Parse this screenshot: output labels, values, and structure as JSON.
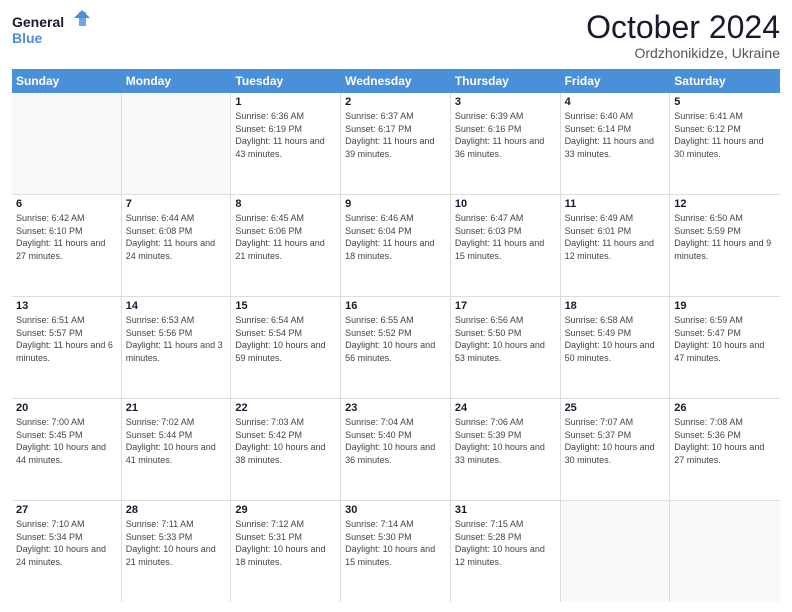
{
  "logo": {
    "line1": "General",
    "line2": "Blue"
  },
  "title": "October 2024",
  "subtitle": "Ordzhonikidze, Ukraine",
  "days": [
    "Sunday",
    "Monday",
    "Tuesday",
    "Wednesday",
    "Thursday",
    "Friday",
    "Saturday"
  ],
  "weeks": [
    [
      {
        "day": "",
        "info": ""
      },
      {
        "day": "",
        "info": ""
      },
      {
        "day": "1",
        "info": "Sunrise: 6:36 AM\nSunset: 6:19 PM\nDaylight: 11 hours and 43 minutes."
      },
      {
        "day": "2",
        "info": "Sunrise: 6:37 AM\nSunset: 6:17 PM\nDaylight: 11 hours and 39 minutes."
      },
      {
        "day": "3",
        "info": "Sunrise: 6:39 AM\nSunset: 6:16 PM\nDaylight: 11 hours and 36 minutes."
      },
      {
        "day": "4",
        "info": "Sunrise: 6:40 AM\nSunset: 6:14 PM\nDaylight: 11 hours and 33 minutes."
      },
      {
        "day": "5",
        "info": "Sunrise: 6:41 AM\nSunset: 6:12 PM\nDaylight: 11 hours and 30 minutes."
      }
    ],
    [
      {
        "day": "6",
        "info": "Sunrise: 6:42 AM\nSunset: 6:10 PM\nDaylight: 11 hours and 27 minutes."
      },
      {
        "day": "7",
        "info": "Sunrise: 6:44 AM\nSunset: 6:08 PM\nDaylight: 11 hours and 24 minutes."
      },
      {
        "day": "8",
        "info": "Sunrise: 6:45 AM\nSunset: 6:06 PM\nDaylight: 11 hours and 21 minutes."
      },
      {
        "day": "9",
        "info": "Sunrise: 6:46 AM\nSunset: 6:04 PM\nDaylight: 11 hours and 18 minutes."
      },
      {
        "day": "10",
        "info": "Sunrise: 6:47 AM\nSunset: 6:03 PM\nDaylight: 11 hours and 15 minutes."
      },
      {
        "day": "11",
        "info": "Sunrise: 6:49 AM\nSunset: 6:01 PM\nDaylight: 11 hours and 12 minutes."
      },
      {
        "day": "12",
        "info": "Sunrise: 6:50 AM\nSunset: 5:59 PM\nDaylight: 11 hours and 9 minutes."
      }
    ],
    [
      {
        "day": "13",
        "info": "Sunrise: 6:51 AM\nSunset: 5:57 PM\nDaylight: 11 hours and 6 minutes."
      },
      {
        "day": "14",
        "info": "Sunrise: 6:53 AM\nSunset: 5:56 PM\nDaylight: 11 hours and 3 minutes."
      },
      {
        "day": "15",
        "info": "Sunrise: 6:54 AM\nSunset: 5:54 PM\nDaylight: 10 hours and 59 minutes."
      },
      {
        "day": "16",
        "info": "Sunrise: 6:55 AM\nSunset: 5:52 PM\nDaylight: 10 hours and 56 minutes."
      },
      {
        "day": "17",
        "info": "Sunrise: 6:56 AM\nSunset: 5:50 PM\nDaylight: 10 hours and 53 minutes."
      },
      {
        "day": "18",
        "info": "Sunrise: 6:58 AM\nSunset: 5:49 PM\nDaylight: 10 hours and 50 minutes."
      },
      {
        "day": "19",
        "info": "Sunrise: 6:59 AM\nSunset: 5:47 PM\nDaylight: 10 hours and 47 minutes."
      }
    ],
    [
      {
        "day": "20",
        "info": "Sunrise: 7:00 AM\nSunset: 5:45 PM\nDaylight: 10 hours and 44 minutes."
      },
      {
        "day": "21",
        "info": "Sunrise: 7:02 AM\nSunset: 5:44 PM\nDaylight: 10 hours and 41 minutes."
      },
      {
        "day": "22",
        "info": "Sunrise: 7:03 AM\nSunset: 5:42 PM\nDaylight: 10 hours and 38 minutes."
      },
      {
        "day": "23",
        "info": "Sunrise: 7:04 AM\nSunset: 5:40 PM\nDaylight: 10 hours and 36 minutes."
      },
      {
        "day": "24",
        "info": "Sunrise: 7:06 AM\nSunset: 5:39 PM\nDaylight: 10 hours and 33 minutes."
      },
      {
        "day": "25",
        "info": "Sunrise: 7:07 AM\nSunset: 5:37 PM\nDaylight: 10 hours and 30 minutes."
      },
      {
        "day": "26",
        "info": "Sunrise: 7:08 AM\nSunset: 5:36 PM\nDaylight: 10 hours and 27 minutes."
      }
    ],
    [
      {
        "day": "27",
        "info": "Sunrise: 7:10 AM\nSunset: 5:34 PM\nDaylight: 10 hours and 24 minutes."
      },
      {
        "day": "28",
        "info": "Sunrise: 7:11 AM\nSunset: 5:33 PM\nDaylight: 10 hours and 21 minutes."
      },
      {
        "day": "29",
        "info": "Sunrise: 7:12 AM\nSunset: 5:31 PM\nDaylight: 10 hours and 18 minutes."
      },
      {
        "day": "30",
        "info": "Sunrise: 7:14 AM\nSunset: 5:30 PM\nDaylight: 10 hours and 15 minutes."
      },
      {
        "day": "31",
        "info": "Sunrise: 7:15 AM\nSunset: 5:28 PM\nDaylight: 10 hours and 12 minutes."
      },
      {
        "day": "",
        "info": ""
      },
      {
        "day": "",
        "info": ""
      }
    ]
  ]
}
